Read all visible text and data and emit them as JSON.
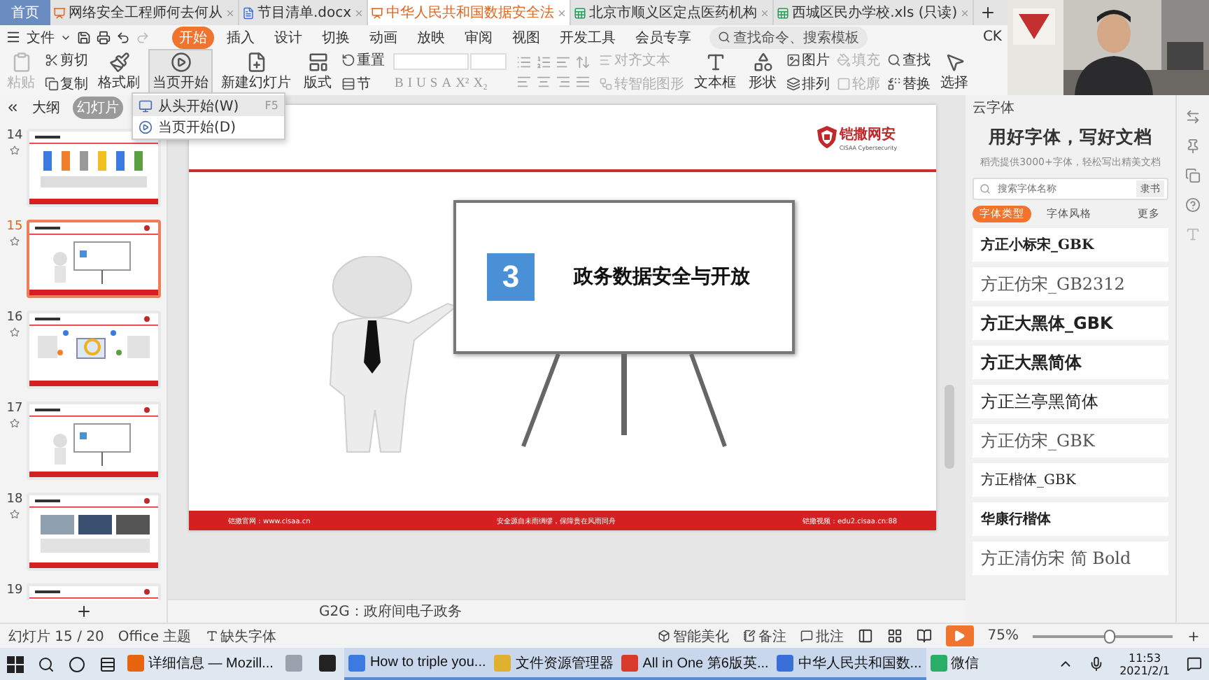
{
  "tabs": [
    {
      "label": "首页",
      "kind": "home",
      "selected": false
    },
    {
      "label": "网络安全工程师何去何从",
      "kind": "wps",
      "selected": false
    },
    {
      "label": "节目清单.docx",
      "kind": "doc",
      "selected": false
    },
    {
      "label": "中华人民共和国数据安全法",
      "kind": "wps",
      "selected": true
    },
    {
      "label": "北京市顺义区定点医药机构",
      "kind": "sheet",
      "selected": false
    },
    {
      "label": "西城区民办学校.xls (只读)",
      "kind": "sheet",
      "selected": false
    }
  ],
  "menu": {
    "file": "文件",
    "account": "CK",
    "search_placeholder": "查找命令、搜索模板",
    "ribbon_tabs": [
      {
        "label": "开始",
        "selected": true
      },
      {
        "label": "插入",
        "selected": false
      },
      {
        "label": "设计",
        "selected": false
      },
      {
        "label": "切换",
        "selected": false
      },
      {
        "label": "动画",
        "selected": false
      },
      {
        "label": "放映",
        "selected": false
      },
      {
        "label": "审阅",
        "selected": false
      },
      {
        "label": "视图",
        "selected": false
      },
      {
        "label": "开发工具",
        "selected": false
      },
      {
        "label": "会员专享",
        "selected": false
      }
    ]
  },
  "ribbon": [
    {
      "kind": "large",
      "label": "粘贴",
      "disabled": true,
      "expanded": false
    },
    {
      "kind": "pair",
      "items": [
        {
          "label": "剪切",
          "disabled": false
        },
        {
          "label": "复制",
          "disabled": false
        }
      ]
    },
    {
      "kind": "large",
      "label": "格式刷",
      "disabled": false,
      "expanded": false
    },
    {
      "kind": "large",
      "label": "当页开始",
      "disabled": false,
      "expanded": true
    },
    {
      "kind": "large",
      "label": "新建幻灯片",
      "disabled": false,
      "expanded": false
    },
    {
      "kind": "large",
      "label": "版式",
      "disabled": false,
      "expanded": false
    },
    {
      "kind": "pair",
      "items": [
        {
          "label": "重置",
          "disabled": false
        },
        {
          "label": "节",
          "disabled": false
        }
      ]
    },
    {
      "kind": "font",
      "glyphs": [
        "B",
        "I",
        "U",
        "S",
        "A",
        "X²",
        "X₂"
      ]
    },
    {
      "kind": "paragraph"
    },
    {
      "kind": "pair",
      "items": [
        {
          "label": "对齐文本",
          "disabled": true
        },
        {
          "label": "转智能图形",
          "disabled": true
        }
      ]
    },
    {
      "kind": "large",
      "label": "文本框",
      "disabled": false,
      "expanded": false
    },
    {
      "kind": "large",
      "label": "形状",
      "disabled": false,
      "expanded": false
    },
    {
      "kind": "pair",
      "items": [
        {
          "label": "图片",
          "disabled": false
        },
        {
          "label": "排列",
          "disabled": false
        }
      ]
    },
    {
      "kind": "pair",
      "items": [
        {
          "label": "填充",
          "disabled": true
        },
        {
          "label": "轮廓",
          "disabled": true
        }
      ]
    },
    {
      "kind": "pair",
      "items": [
        {
          "label": "查找",
          "disabled": false
        },
        {
          "label": "替换",
          "disabled": false
        }
      ]
    },
    {
      "kind": "large",
      "label": "选择",
      "disabled": false,
      "expanded": false
    }
  ],
  "dropdown": [
    {
      "label": "从头开始(W)",
      "shortcut": "F5",
      "selected": true
    },
    {
      "label": "当页开始(D)",
      "selected": false
    }
  ],
  "panel_tabs": [
    {
      "label": "大纲",
      "selected": false
    },
    {
      "label": "幻灯片",
      "selected": true
    }
  ],
  "slides": [
    {
      "number": "14",
      "kind": "bars",
      "selected": false
    },
    {
      "number": "15",
      "kind": "board",
      "selected": true
    },
    {
      "number": "16",
      "kind": "diagram",
      "selected": false
    },
    {
      "number": "17",
      "kind": "board",
      "selected": false
    },
    {
      "number": "18",
      "kind": "photos",
      "selected": false
    },
    {
      "number": "19",
      "kind": "partial",
      "selected": false
    }
  ],
  "slide": {
    "logo_name": "铠撒网安",
    "logo_sub": "CISAA Cybersecurity",
    "section_number": "3",
    "title": "政务数据安全与开放",
    "footer": [
      "铠撒官网：www.cisaa.cn",
      "安全源自未雨绸缪，保障贵在风雨同舟",
      "铠撒视频：edu2.cisaa.cn:88"
    ]
  },
  "notes": "G2G：政府间电子政务",
  "font_panel": {
    "header": "云字体",
    "title": "用好字体，写好文档",
    "subtitle": "稻壳提供3000+字体，轻松写出精美文档",
    "search_placeholder": "搜索字体名称",
    "search_button": "隶书",
    "filters": [
      {
        "label": "字体类型",
        "selected": true
      },
      {
        "label": "字体风格",
        "selected": false
      }
    ],
    "more": "更多",
    "fonts": [
      {
        "name": "方正小标宋_GBK",
        "kind": "heavy-serif"
      },
      {
        "name": "方正仿宋_GB2312",
        "kind": "light-serif"
      },
      {
        "name": "方正大黑体_GBK",
        "kind": "bold"
      },
      {
        "name": "方正大黑简体",
        "kind": "bold"
      },
      {
        "name": "方正兰亭黑简体",
        "kind": "regular"
      },
      {
        "name": "方正仿宋_GBK",
        "kind": "light-serif"
      },
      {
        "name": "方正楷体_GBK",
        "kind": "serif"
      },
      {
        "name": "华康行楷体",
        "kind": "heavy-serif"
      },
      {
        "name": "方正清仿宋 简 Bold",
        "kind": "light-serif"
      }
    ]
  },
  "status": {
    "slide_counter": "幻灯片 15 / 20",
    "theme": "Office 主题",
    "missing_fonts": "缺失字体",
    "beautify": "智能美化",
    "notes": "备注",
    "comments": "批注",
    "zoom": "75%",
    "zoom_level": {
      "level": 0.55
    }
  },
  "taskbar": {
    "apps": [
      {
        "label": "详细信息 — Mozill...",
        "color": "#e8650f",
        "active": false
      },
      {
        "color": "#9aa3ad",
        "active": false
      },
      {
        "color": "#222222",
        "active": false
      },
      {
        "label": "How to triple you...",
        "color": "#3b7be0",
        "active": true
      },
      {
        "label": "文件资源管理器",
        "color": "#e0b030",
        "active": true
      },
      {
        "label": "All in One 第6版英...",
        "color": "#d83a2c",
        "active": true
      },
      {
        "label": "中华人民共和国数...",
        "color": "#3a6fd8",
        "active": true
      },
      {
        "label": "微信",
        "color": "#2aae67",
        "active": false
      }
    ],
    "time": "11:53",
    "date": "2021/2/1"
  }
}
